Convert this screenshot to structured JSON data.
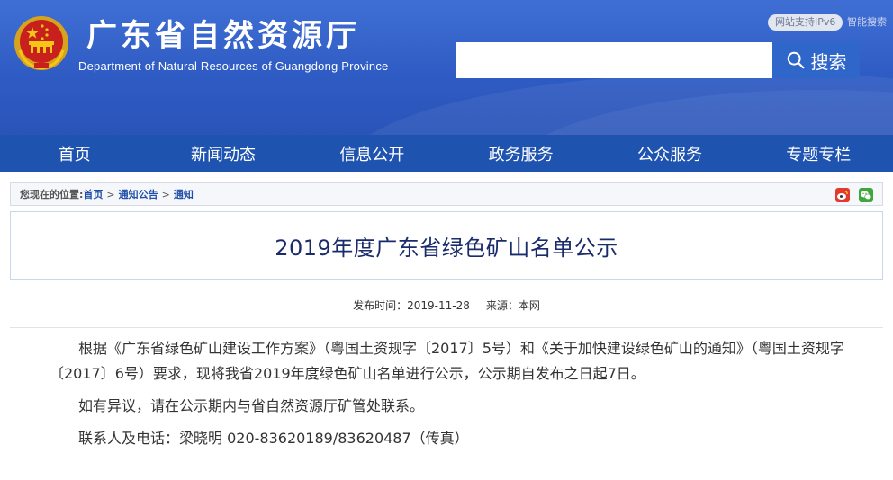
{
  "header": {
    "site_title": "广东省自然资源厅",
    "site_subtitle": "Department of Natural Resources of Guangdong Province",
    "ipv6_badge": "网站支持IPv6",
    "top_link": "智能搜索",
    "search": {
      "value": "",
      "placeholder": "",
      "button_label": "搜索"
    }
  },
  "nav": {
    "items": [
      {
        "label": "首页"
      },
      {
        "label": "新闻动态"
      },
      {
        "label": "信息公开"
      },
      {
        "label": "政务服务"
      },
      {
        "label": "公众服务"
      },
      {
        "label": "专题专栏"
      }
    ]
  },
  "breadcrumb": {
    "prefix": "您现在的位置:",
    "items": [
      "首页",
      "通知公告",
      "通知"
    ],
    "separator": ">"
  },
  "article": {
    "title": "2019年度广东省绿色矿山名单公示",
    "publish_label": "发布时间：",
    "publish_date": "2019-11-28",
    "source_label": "来源：",
    "source": "本网",
    "paragraphs": [
      "根据《广东省绿色矿山建设工作方案》（粤国土资规字〔2017〕5号）和《关于加快建设绿色矿山的通知》（粤国土资规字〔2017〕6号）要求，现将我省2019年度绿色矿山名单进行公示，公示期自发布之日起7日。",
      "如有异议，请在公示期内与省自然资源厅矿管处联系。",
      "联系人及电话：梁晓明 020-83620189/83620487（传真）"
    ]
  },
  "colors": {
    "header_blue": "#3f6fd4",
    "nav_blue": "#1e53b0",
    "search_button": "#2f66c9",
    "title_text": "#1a2b6b",
    "link": "#1f4fa8"
  },
  "icons": {
    "emblem": "national-emblem-icon",
    "search": "search-icon",
    "weibo": "weibo-icon",
    "wechat": "wechat-icon"
  }
}
